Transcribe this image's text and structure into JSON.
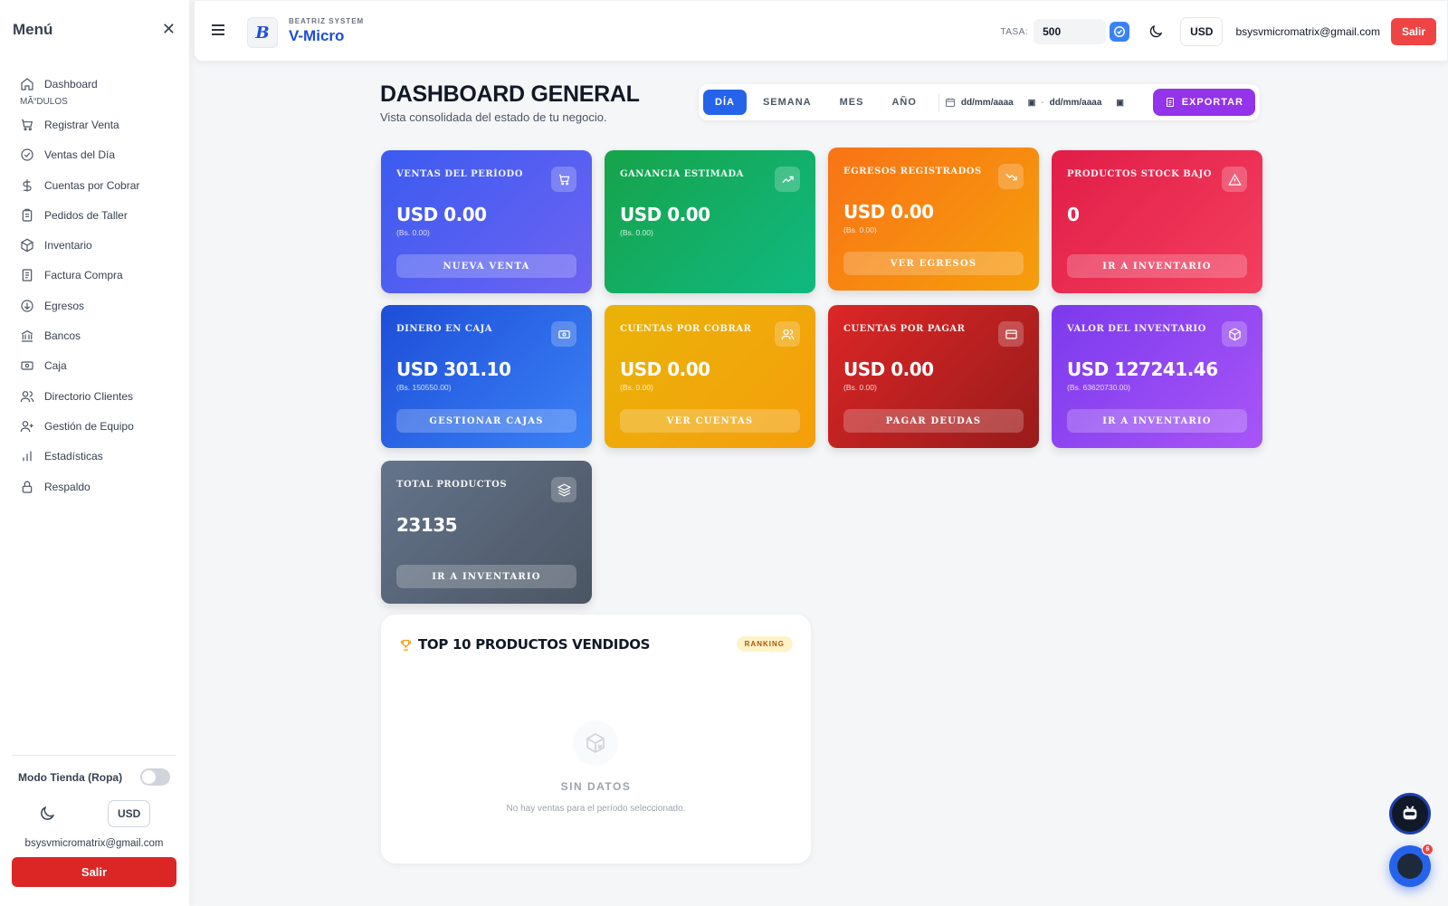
{
  "sidebar": {
    "title": "Menú",
    "section_label": "MÃ“DULOS",
    "items": [
      {
        "label": "Dashboard",
        "icon": "home-icon"
      },
      {
        "label": "Registrar Venta",
        "icon": "cart-icon"
      },
      {
        "label": "Ventas del Día",
        "icon": "check-circle-icon"
      },
      {
        "label": "Cuentas por Cobrar",
        "icon": "dollar-icon"
      },
      {
        "label": "Pedidos de Taller",
        "icon": "clipboard-icon"
      },
      {
        "label": "Inventario",
        "icon": "box-icon"
      },
      {
        "label": "Factura Compra",
        "icon": "document-icon"
      },
      {
        "label": "Egresos",
        "icon": "arrow-down-circle-icon"
      },
      {
        "label": "Bancos",
        "icon": "bank-icon"
      },
      {
        "label": "Caja",
        "icon": "cash-icon"
      },
      {
        "label": "Directorio Clientes",
        "icon": "users-icon"
      },
      {
        "label": "Gestión de Equipo",
        "icon": "user-plus-icon"
      },
      {
        "label": "Estadísticas",
        "icon": "bar-chart-icon"
      },
      {
        "label": "Respaldo",
        "icon": "lock-icon"
      }
    ],
    "modo_label": "Modo Tienda (Ropa)",
    "currency": "USD",
    "email": "bsysvmicromatrix@gmail.com",
    "salir": "Salir"
  },
  "topbar": {
    "brand_sub": "BEATRIZ SYSTEM",
    "brand_name": "V-Micro",
    "logo_letter": "B",
    "tasa_label": "TASA:",
    "tasa_value": "500",
    "currency": "USD",
    "email": "bsysvmicromatrix@gmail.com",
    "salir": "Salir"
  },
  "header": {
    "title": "DASHBOARD GENERAL",
    "subtitle": "Vista consolidada del estado de tu negocio.",
    "tabs": [
      "DÍA",
      "SEMANA",
      "MES",
      "AÑO"
    ],
    "active_tab": "DÍA",
    "date_from_placeholder": "dd/mm/aaaa",
    "date_to_placeholder": "dd/mm/aaaa",
    "date_separator": "-",
    "export": "EXPORTAR"
  },
  "cards": [
    {
      "title": "VENTAS DEL PERÍODO",
      "value": "USD 0.00",
      "bs": "(Bs. 0.00)",
      "button": "NUEVA VENTA",
      "icon": "cart-icon",
      "color": "#4f5ef0"
    },
    {
      "title": "GANANCIA ESTIMADA",
      "value": "USD 0.00",
      "bs": "(Bs. 0.00)",
      "button": "",
      "icon": "trending-up-icon",
      "color": "#16a34a"
    },
    {
      "title": "EGRESOS REGISTRADOS",
      "value": "USD 0.00",
      "bs": "(Bs. 0.00)",
      "button": "VER EGRESOS",
      "icon": "trending-down-icon",
      "color": "#f97316"
    },
    {
      "title": "PRODUCTOS STOCK BAJO",
      "value": "0",
      "bs": "",
      "button": "IR A INVENTARIO",
      "icon": "warning-icon",
      "color": "#e11d48"
    },
    {
      "title": "DINERO EN CAJA",
      "value": "USD 301.10",
      "bs": "(Bs. 150550.00)",
      "button": "GESTIONAR CAJAS",
      "icon": "cash-icon",
      "color": "#2563eb"
    },
    {
      "title": "CUENTAS POR COBRAR",
      "value": "USD 0.00",
      "bs": "(Bs. 0.00)",
      "button": "VER CUENTAS",
      "icon": "users-icon",
      "color": "#f59e0b"
    },
    {
      "title": "CUENTAS POR PAGAR",
      "value": "USD 0.00",
      "bs": "(Bs. 0.00)",
      "button": "PAGAR DEUDAS",
      "icon": "credit-card-icon",
      "color": "#c81e1e"
    },
    {
      "title": "VALOR DEL INVENTARIO",
      "value": "USD 127241.46",
      "bs": "(Bs. 63620730.00)",
      "button": "IR A INVENTARIO",
      "icon": "box-icon",
      "color": "#8b5cf6"
    },
    {
      "title": "TOTAL PRODUCTOS",
      "value": "23135",
      "bs": "",
      "button": "IR A INVENTARIO",
      "icon": "layers-icon",
      "color": "#5b6475"
    }
  ],
  "top10": {
    "title": "TOP 10 PRODUCTOS VENDIDOS",
    "badge": "RANKING",
    "empty_title": "SIN DATOS",
    "empty_text": "No hay ventas para el período seleccionado."
  },
  "fab": {
    "badge": "6"
  }
}
